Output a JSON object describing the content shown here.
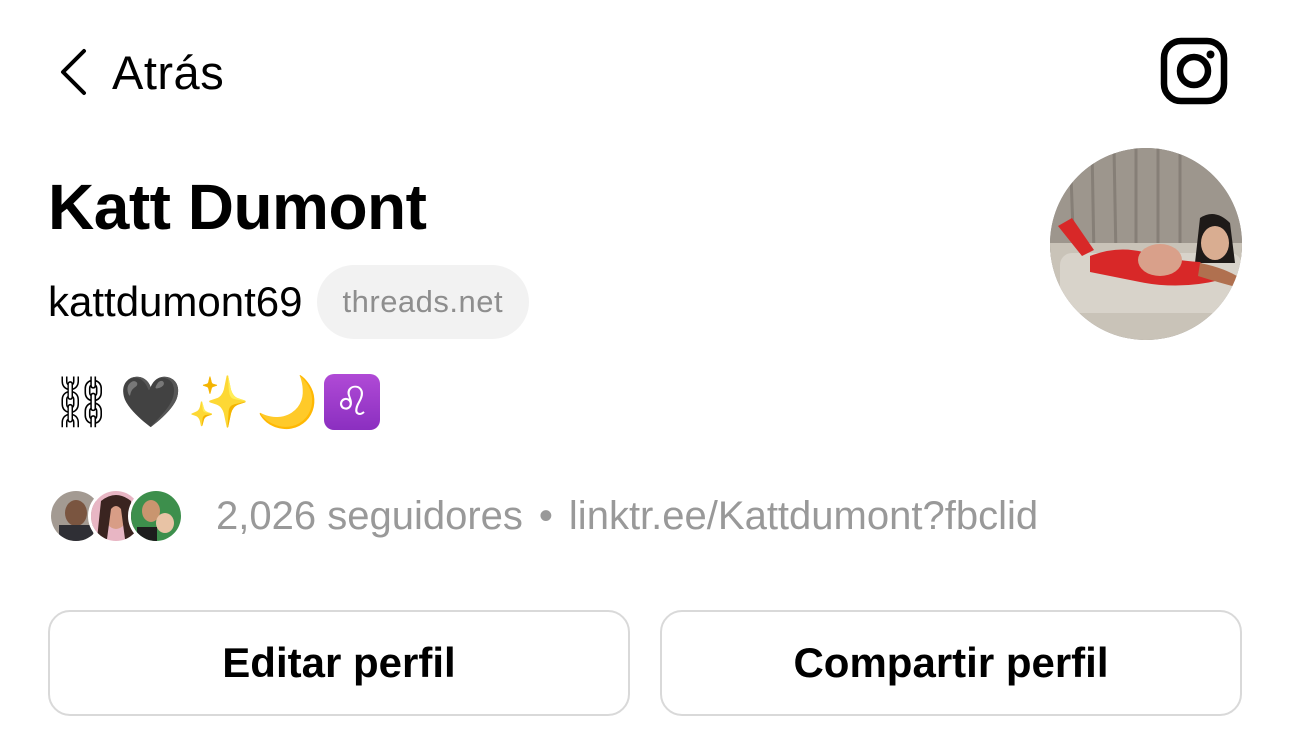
{
  "header": {
    "back_label": "Atrás",
    "instagram_icon": "instagram-icon",
    "back_icon": "chevron-left-icon"
  },
  "profile": {
    "name": "Katt Dumont",
    "username": "kattdumont69",
    "domain_badge": "threads.net",
    "bio_emojis": [
      "⛓",
      "🖤",
      "✨",
      "🌙",
      "♌"
    ],
    "followers_count": "2,026 seguidores",
    "separator": "•",
    "link": "linktr.ee/Kattdumont?fbclid"
  },
  "actions": {
    "edit_label": "Editar perfil",
    "share_label": "Compartir perfil"
  },
  "colors": {
    "muted_text": "#999999",
    "pill_bg": "#f2f2f2",
    "button_border": "#d9d9d9"
  }
}
